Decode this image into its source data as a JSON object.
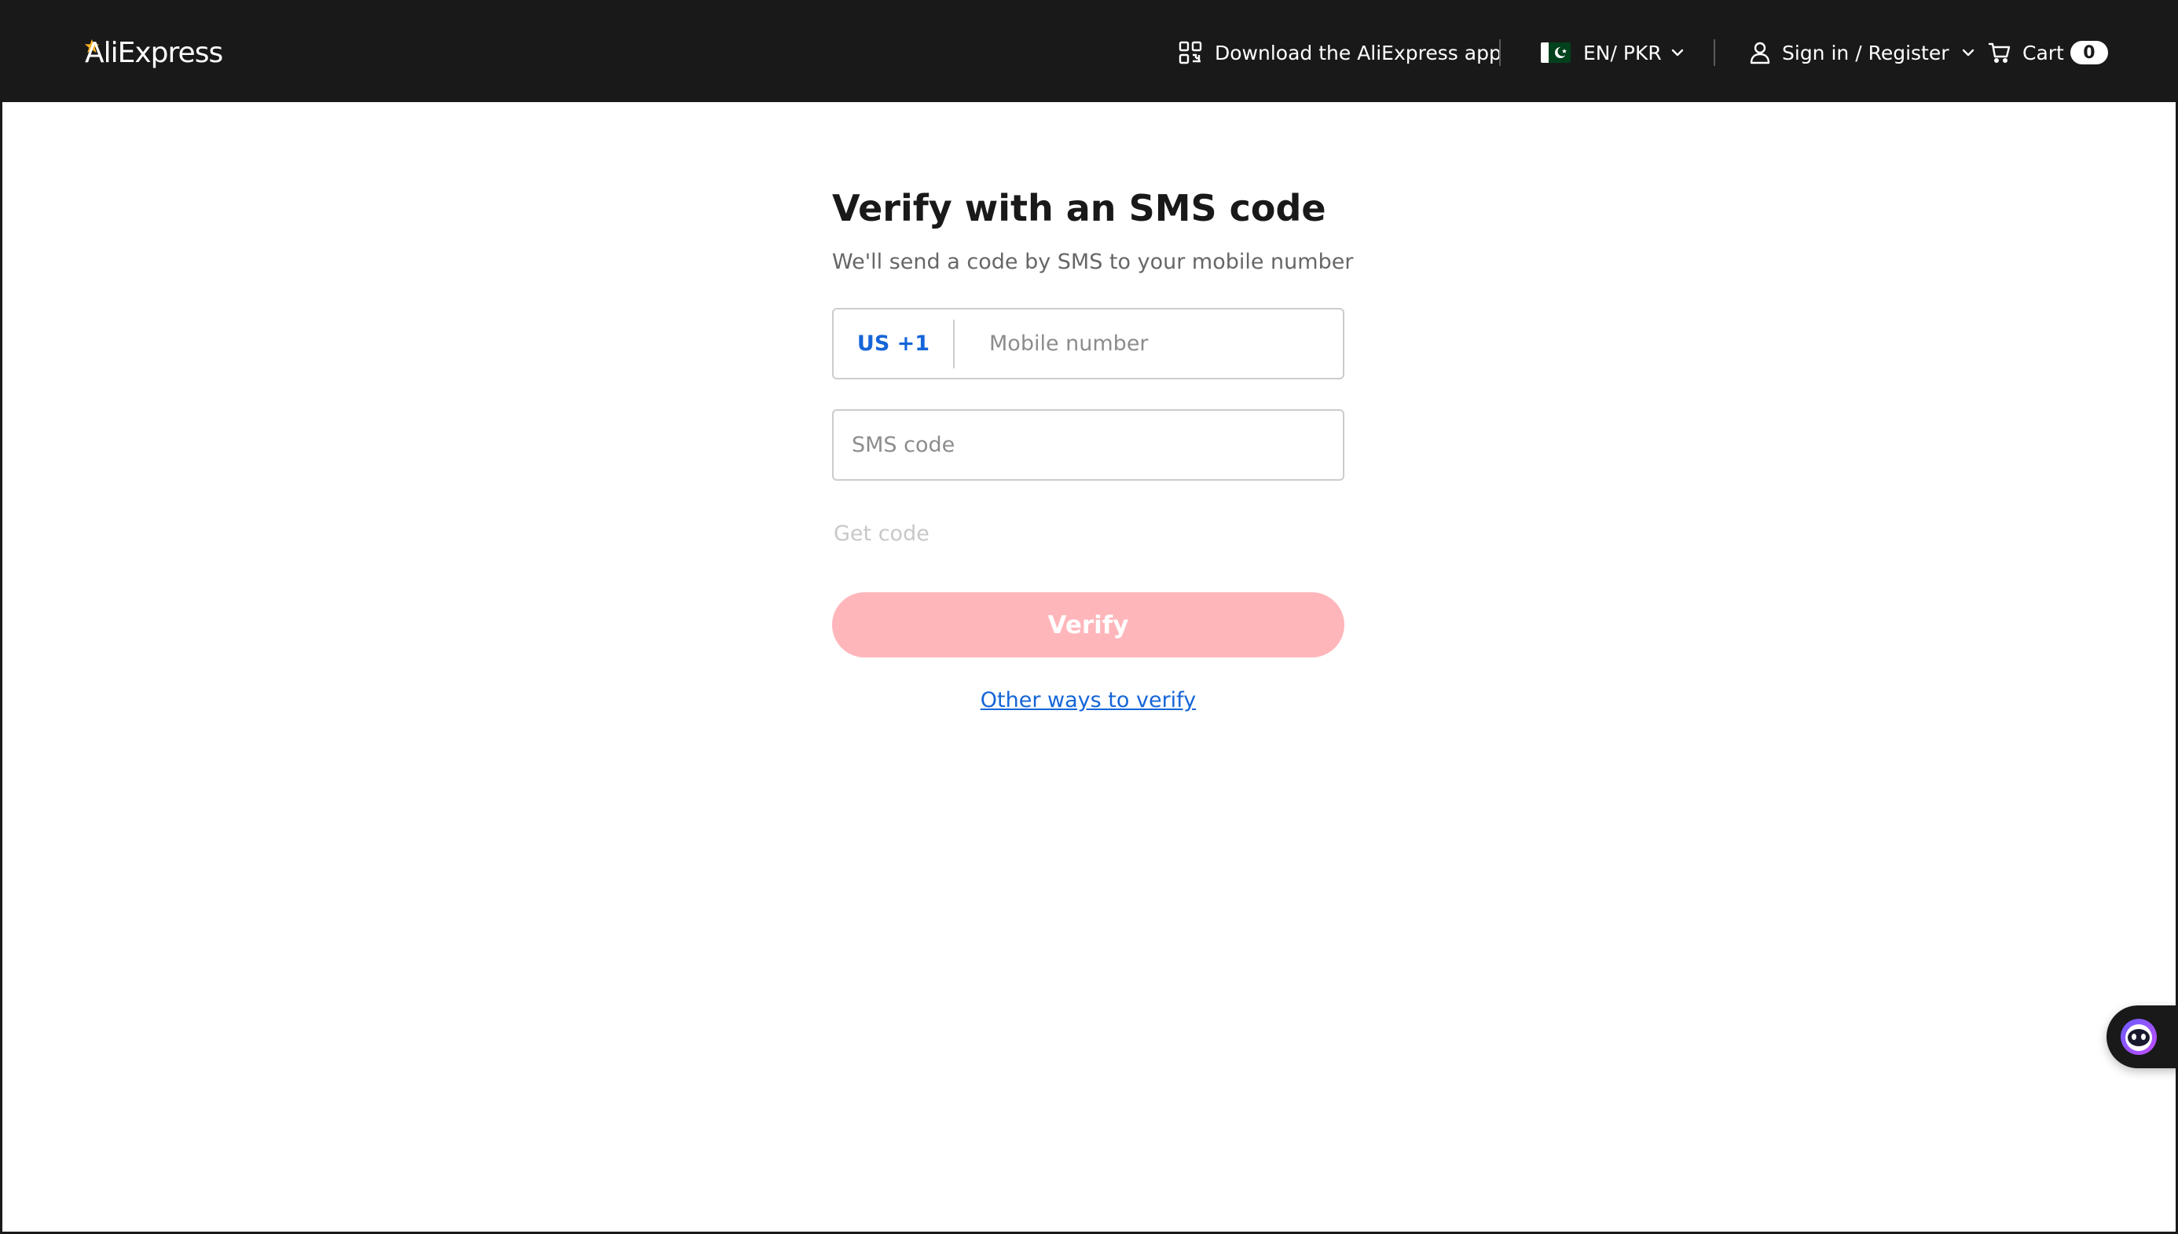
{
  "header": {
    "logo_text": "AliExpress",
    "download_app_label": "Download the AliExpress app",
    "language_currency": "EN/ PKR",
    "sign_in_label": "Sign in / Register",
    "cart_label": "Cart",
    "cart_count": "0"
  },
  "form": {
    "title": "Verify with an SMS code",
    "subtitle": "We'll send a code by SMS to your mobile number",
    "country_code": "US +1",
    "mobile_placeholder": "Mobile number",
    "mobile_value": "",
    "sms_placeholder": "SMS code",
    "sms_value": "",
    "get_code_label": "Get code",
    "verify_label": "Verify",
    "other_ways_label": "Other ways to verify"
  },
  "icons": {
    "logo_accent": "star-icon",
    "download_app": "qr-code-icon",
    "flag": "pakistan-flag-icon",
    "user": "user-icon",
    "cart": "cart-icon",
    "chevron": "chevron-down-icon",
    "assistant": "chatbot-icon"
  },
  "colors": {
    "header_bg": "#191919",
    "accent_link": "#1565d8",
    "verify_button_disabled": "#ffb6bb",
    "placeholder": "#8c8c8c",
    "get_code_disabled": "#c8c8c8",
    "flag_green": "#01411c",
    "logo_star": "#f7b125"
  }
}
